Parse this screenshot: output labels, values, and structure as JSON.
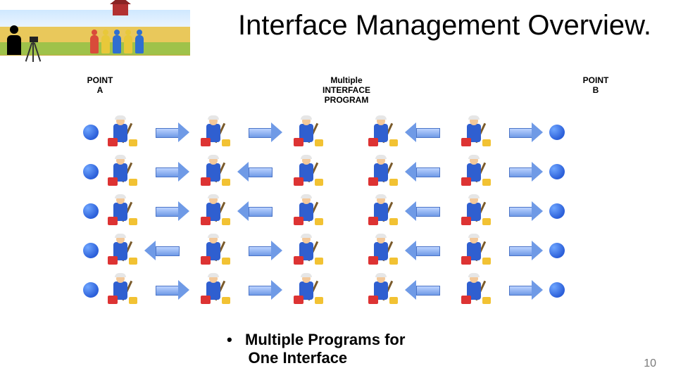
{
  "title": "Interface Management Overview.",
  "labels": {
    "pointA": "POINT\nA",
    "middle": "Multiple\nINTERFACE\nPROGRAM",
    "pointB": "POINT\nB"
  },
  "bullet": "•   Multiple Programs for\n     One Interface",
  "pageNumber": "10",
  "crowdColors": [
    "#d94b3a",
    "#e8c83a",
    "#2f6fd0",
    "#e8c83a",
    "#2f6fd0"
  ],
  "diagram": {
    "rows": [
      {
        "left": [
          "W",
          "R",
          "W",
          "R",
          "W"
        ],
        "right": [
          "W",
          "L",
          "W",
          "R"
        ]
      },
      {
        "left": [
          "W",
          "R",
          "W",
          "L",
          "W"
        ],
        "right": [
          "W",
          "L",
          "W",
          "R"
        ]
      },
      {
        "left": [
          "W",
          "R",
          "W",
          "L",
          "W"
        ],
        "right": [
          "W",
          "L",
          "W",
          "R"
        ]
      },
      {
        "left": [
          "W",
          "L",
          "W",
          "R",
          "W"
        ],
        "right": [
          "W",
          "L",
          "W",
          "R"
        ]
      },
      {
        "left": [
          "W",
          "R",
          "W",
          "R",
          "W"
        ],
        "right": [
          "W",
          "L",
          "W",
          "R"
        ]
      }
    ]
  }
}
